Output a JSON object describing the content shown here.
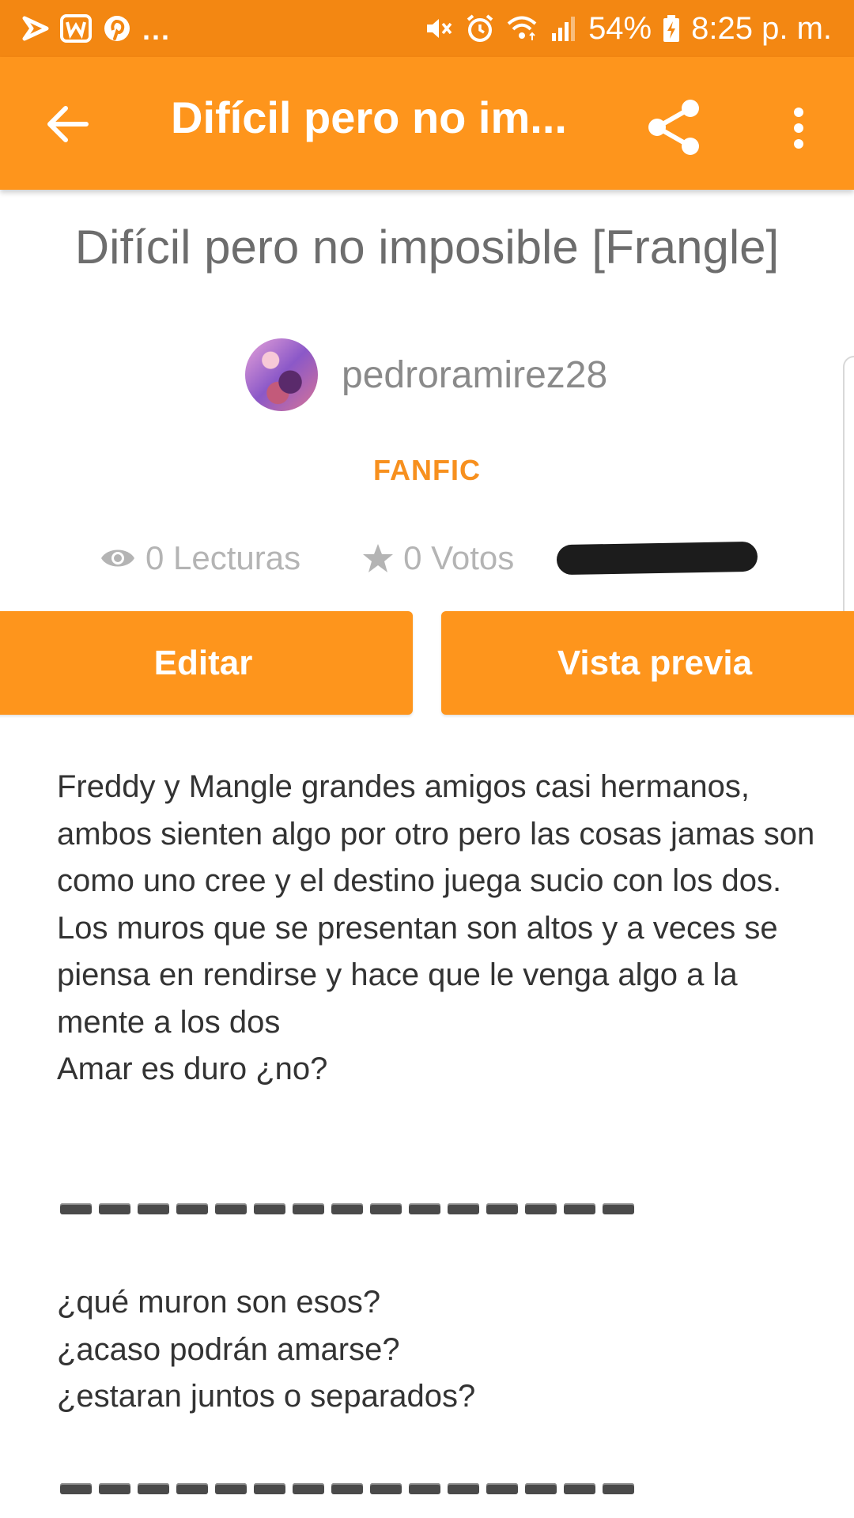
{
  "status_bar": {
    "notification_overflow": "...",
    "battery": "54%",
    "time": "8:25 p. m.",
    "left_icons": [
      "checkmark-play-icon",
      "wattpad-w-icon",
      "pinterest-icon"
    ],
    "right_icons": [
      "vibrate-mute-icon",
      "alarm-icon",
      "wifi-icon",
      "signal-icon",
      "battery-charging-icon"
    ]
  },
  "app_bar": {
    "title": "Difícil pero no im...",
    "back_icon": "arrow-left-icon",
    "share_icon": "share-icon",
    "more_icon": "more-vert-icon"
  },
  "story": {
    "title": "Difícil pero no imposible  [Frangle]",
    "author": "pedroramirez28",
    "category": "FANFIC",
    "reads_label": "0 Lecturas",
    "votes_label": "0 Votos"
  },
  "actions": {
    "edit_label": "Editar",
    "preview_label": "Vista previa"
  },
  "description": {
    "paragraphs": [
      "Freddy y Mangle grandes amigos casi hermanos, ambos sienten algo por otro pero las cosas jamas son como uno cree y el destino juega sucio con los dos.",
      "Los muros que se presentan son altos y a veces se piensa en rendirse y hace que le venga algo a la mente a los dos",
      "Amar es duro ¿no?"
    ],
    "questions": [
      "¿qué muron son esos?",
      "¿acaso podrán amarse?",
      "¿estaran juntos o separados?"
    ]
  },
  "colors": {
    "status_bar": "#f38712",
    "app_bar": "#fe951c",
    "accent": "#f7901e"
  }
}
